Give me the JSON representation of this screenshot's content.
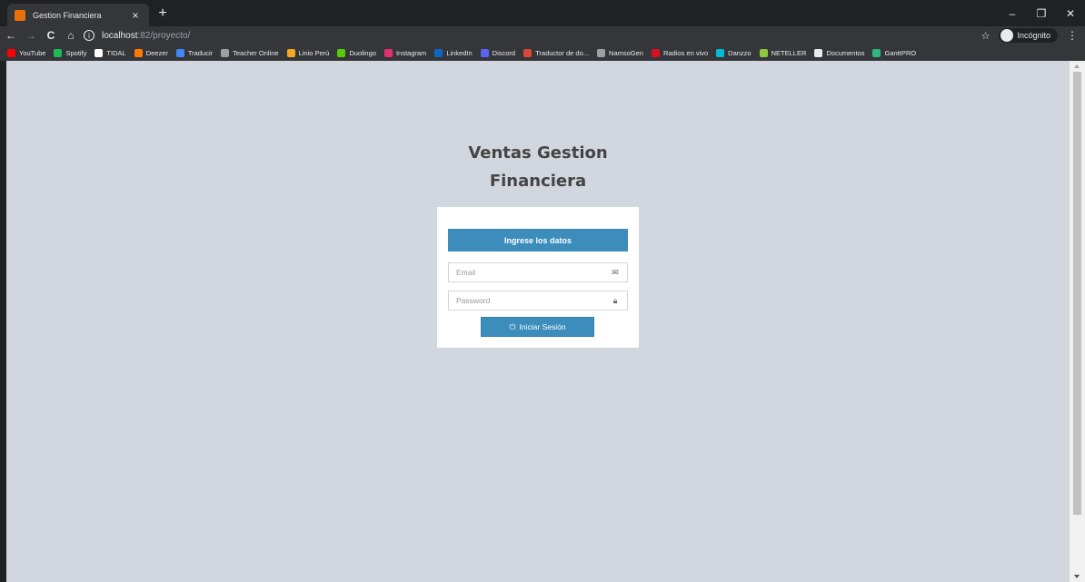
{
  "browser": {
    "tab_title": "Gestion Financiera",
    "tab_close": "×",
    "new_tab": "+",
    "url_host": "localhost",
    "url_rest": ":82/proyecto/",
    "incognito_label": "Incógnito",
    "window_controls": {
      "minimize": "–",
      "restore": "❐",
      "close": "✕"
    },
    "nav": {
      "back": "←",
      "forward": "→",
      "reload": "C",
      "home": "⌂"
    },
    "bookmarks": [
      {
        "label": "YouTube",
        "color": "#ff0000"
      },
      {
        "label": "Spotify",
        "color": "#1db954"
      },
      {
        "label": "TIDAL",
        "color": "#ffffff"
      },
      {
        "label": "Deezer",
        "color": "#ff7a00"
      },
      {
        "label": "Traducir",
        "color": "#4285f4"
      },
      {
        "label": "Teacher Online",
        "color": "#9aa0a6"
      },
      {
        "label": "Linio Perú",
        "color": "#f5a623"
      },
      {
        "label": "Duolingo",
        "color": "#58cc02"
      },
      {
        "label": "Instagram",
        "color": "#e1306c"
      },
      {
        "label": "LinkedIn",
        "color": "#0a66c2"
      },
      {
        "label": "Discord",
        "color": "#5865f2"
      },
      {
        "label": "Traductor de do...",
        "color": "#db4437"
      },
      {
        "label": "NamsoGen",
        "color": "#9aa0a6"
      },
      {
        "label": "Radios en vivo",
        "color": "#d91023"
      },
      {
        "label": "Danzzo",
        "color": "#00bcd4"
      },
      {
        "label": "NETELLER",
        "color": "#8dc63f"
      },
      {
        "label": "Documentos",
        "color": "#e8eaed"
      },
      {
        "label": "GanttPRO",
        "color": "#2eb67d"
      }
    ]
  },
  "page": {
    "brand_line1": "Ventas Gestion",
    "brand_line2": "Financiera",
    "box_header": "Ingrese los datos",
    "email_placeholder": "Email",
    "password_placeholder": "Password",
    "login_button": "Iniciar Sesión"
  },
  "colors": {
    "background": "#d2d6de",
    "primary": "#3c8dbc"
  }
}
